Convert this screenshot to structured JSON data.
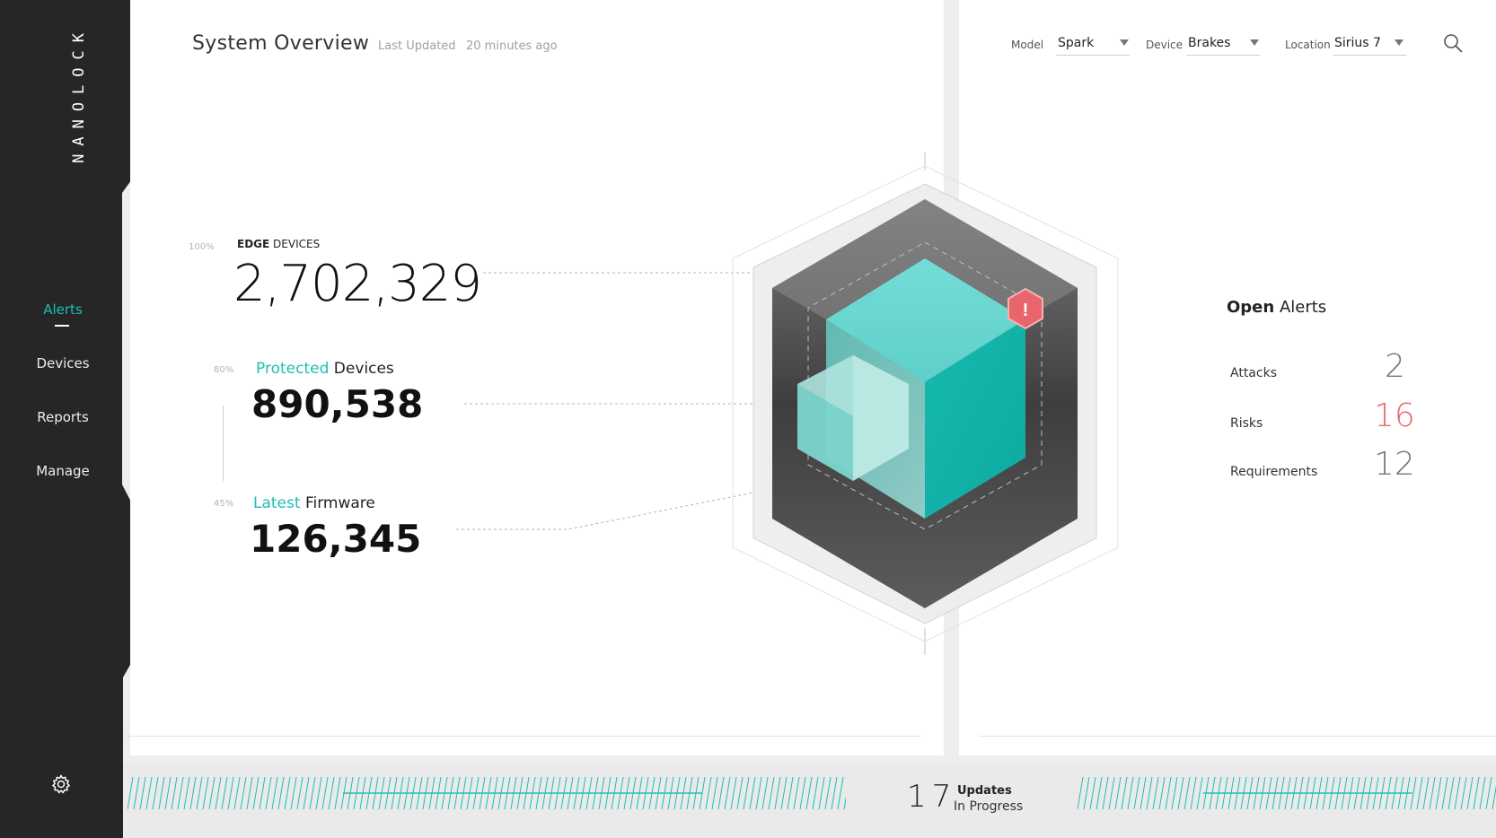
{
  "brand": {
    "logo": "NANOLOCK"
  },
  "sidebar": {
    "items": [
      {
        "label": "Alerts",
        "active": true
      },
      {
        "label": "Devices"
      },
      {
        "label": "Reports"
      },
      {
        "label": "Manage"
      }
    ],
    "settings_icon": "gear-icon"
  },
  "header": {
    "title": "System Overview",
    "last_updated_label": "Last Updated",
    "last_updated_value": "20 minutes ago"
  },
  "filters": {
    "model": {
      "label": "Model",
      "value": "Spark"
    },
    "device": {
      "label": "Device",
      "value": "Brakes"
    },
    "location": {
      "label": "Location",
      "value": "Sirius 7"
    },
    "search_icon": "search-icon"
  },
  "stats": {
    "edge": {
      "pct": "100%",
      "label_bold": "EDGE",
      "label_rest": " DEVICES",
      "value": "2,702,329"
    },
    "protected": {
      "pct": "80%",
      "label_accent": "Protected",
      "label_rest": " Devices",
      "value": "890,538"
    },
    "firmware": {
      "pct": "45%",
      "label_accent": "Latest",
      "label_rest": " Firmware",
      "value": "126,345"
    }
  },
  "alerts": {
    "title_bold": "Open",
    "title_rest": " Alerts",
    "items": [
      {
        "label": "Attacks",
        "count": "2"
      },
      {
        "label": "Risks",
        "count": "16"
      },
      {
        "label": "Requirements",
        "count": "12"
      }
    ],
    "warning_icon_glyph": "!"
  },
  "updates": {
    "count": "17",
    "title": "Updates",
    "subtitle": "In Progress"
  },
  "colors": {
    "accent": "#1dbfb4",
    "alert_red": "#e8666b",
    "sidebar_bg": "#262626"
  }
}
